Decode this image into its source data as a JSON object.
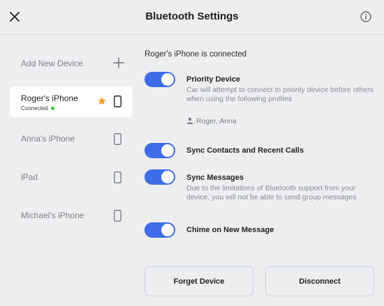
{
  "header": {
    "title": "Bluetooth Settings",
    "close_icon": "close-icon",
    "info_icon": "info-icon"
  },
  "sidebar": {
    "add_device_label": "Add New Device",
    "devices": [
      {
        "name": "Roger's iPhone",
        "status": "Connected",
        "active": true,
        "priority": true
      },
      {
        "name": "Anna's iPhone"
      },
      {
        "name": "iPad"
      },
      {
        "name": "Michael's iPhone"
      }
    ]
  },
  "main": {
    "connected_label": "Roger's iPhone is connected",
    "settings": [
      {
        "title": "Priority Device",
        "description": "Car will attempt to connect to priority device before others when using the following profiles",
        "enabled": true
      },
      {
        "title": "Sync Contacts and Recent Calls",
        "enabled": true
      },
      {
        "title": "Sync Messages",
        "description": "Due to the limitations of Bluetooth support from your device, you will not be able to send group messages",
        "enabled": true
      },
      {
        "title": "Chime on New Message",
        "enabled": true
      }
    ],
    "profiles": "Roger, Anna",
    "buttons": {
      "forget": "Forget Device",
      "disconnect": "Disconnect"
    }
  },
  "colors": {
    "accent": "#3d6ce6",
    "star": "#f0a020",
    "status_dot": "#2ecc40",
    "background": "#eceef0"
  }
}
